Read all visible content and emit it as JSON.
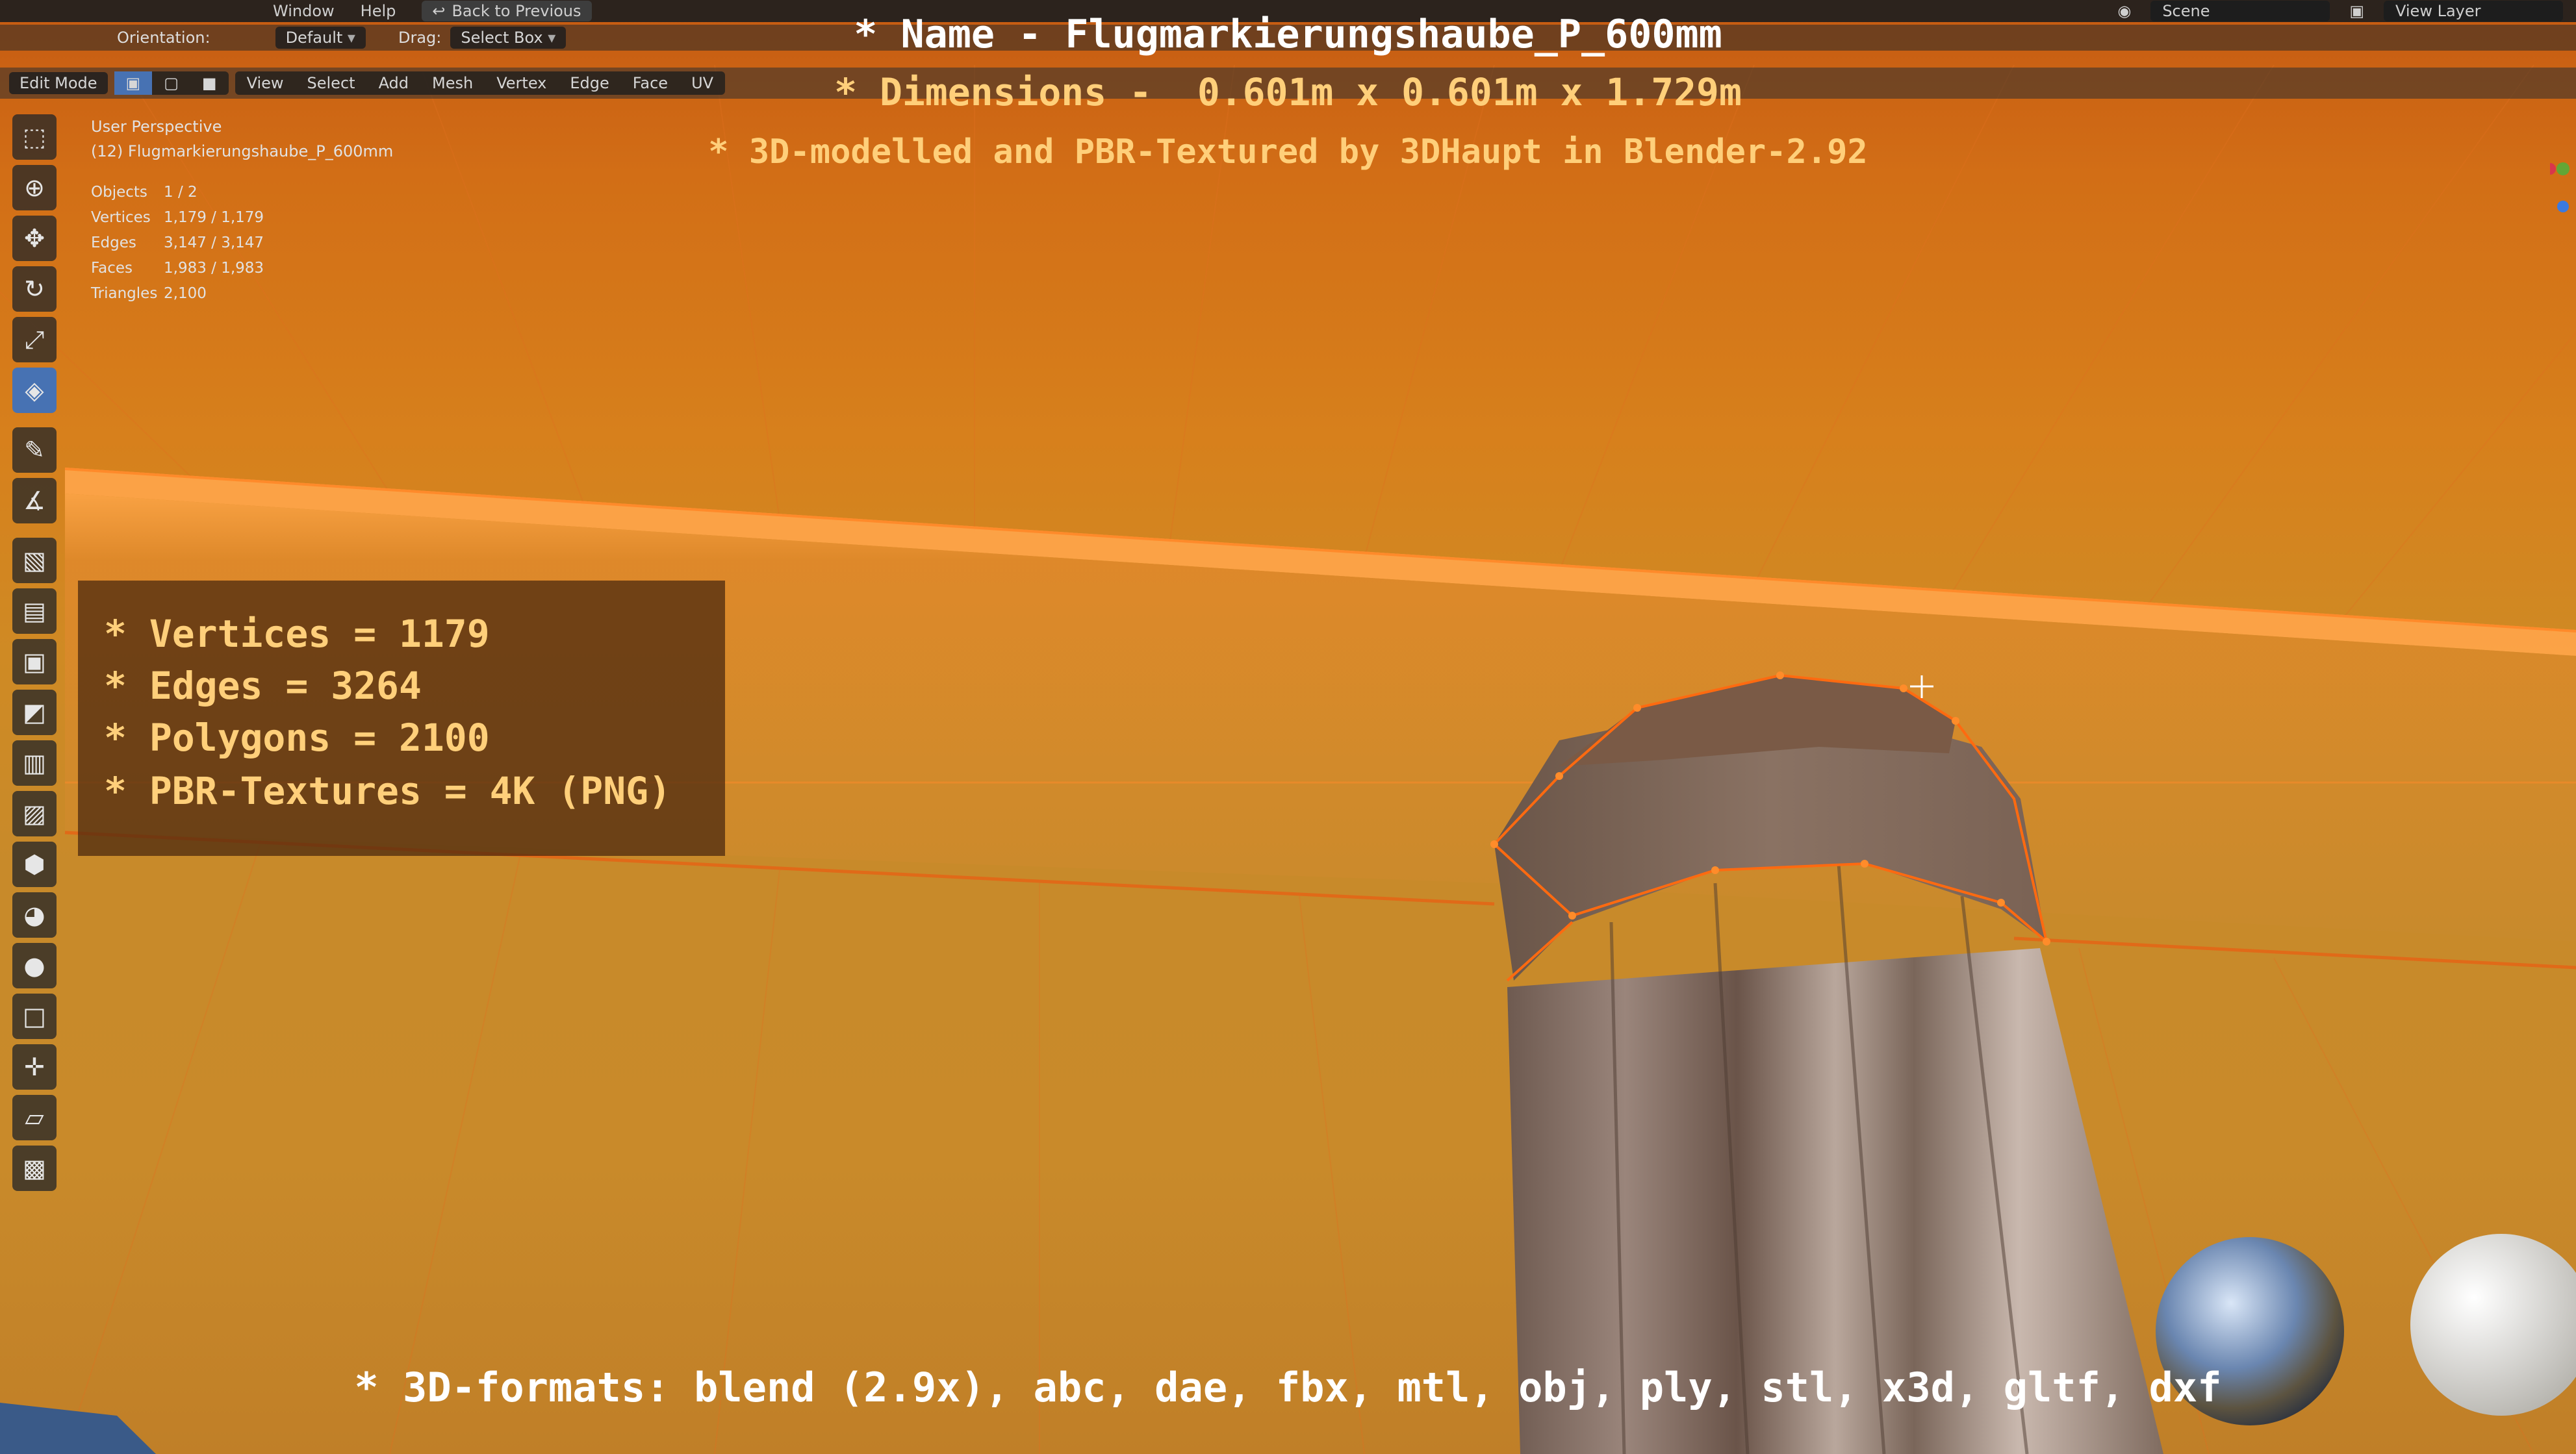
{
  "topbar": {
    "menu": [
      "Window",
      "Help"
    ],
    "back_button": "Back to Previous",
    "scene_field": "Scene",
    "view_layer_field": "View Layer"
  },
  "toolbar": {
    "orientation_label": "Orientation:",
    "orientation_value": "Default",
    "drag_label": "Drag:",
    "drag_value": "Select Box"
  },
  "header": {
    "mode": "Edit Mode",
    "menus": [
      "View",
      "Select",
      "Add",
      "Mesh",
      "Vertex",
      "Edge",
      "Face",
      "UV"
    ]
  },
  "viewport": {
    "perspective": "User Perspective",
    "object_name": "(12) Flugmarkierungshaube_P_600mm",
    "stats": [
      {
        "label": "Objects",
        "value": "1 / 2"
      },
      {
        "label": "Vertices",
        "value": "1,179 / 1,179"
      },
      {
        "label": "Edges",
        "value": "3,147 / 3,147"
      },
      {
        "label": "Faces",
        "value": "1,983 / 1,983"
      },
      {
        "label": "Triangles",
        "value": "2,100"
      }
    ]
  },
  "overlay": {
    "name_line": "* Name - Flugmarkierungshaube_P_600mm",
    "dimensions_line": "* Dimensions -  0.601m x 0.601m x 1.729m",
    "credit_line": "* 3D-modelled and PBR-Textured by 3DHaupt in Blender-2.92",
    "specs": [
      "* Vertices = 1179",
      "* Edges = 3264",
      "* Polygons = 2100",
      "* PBR-Textures = 4K (PNG)"
    ],
    "formats_line": "* 3D-formats: blend (2.9x), abc, dae, fbx, mtl, obj, ply, stl, x3d, gltf, dxf"
  },
  "tools": [
    "select-box-icon",
    "cursor-icon",
    "move-icon",
    "rotate-icon",
    "scale-icon",
    "transform-icon",
    "annotate-icon",
    "measure-icon",
    "add-cube-icon",
    "extrude-region-icon",
    "inset-faces-icon",
    "bevel-icon",
    "loop-cut-icon",
    "knife-icon",
    "poly-build-icon",
    "spin-icon",
    "smooth-icon",
    "edge-slide-icon",
    "shrink-fatten-icon",
    "shear-icon",
    "rip-region-icon"
  ],
  "colors": {
    "accent": "#4772b3",
    "overlay_highlight": "#ffcf7a",
    "mesh_wire": "#ff7a1a"
  }
}
